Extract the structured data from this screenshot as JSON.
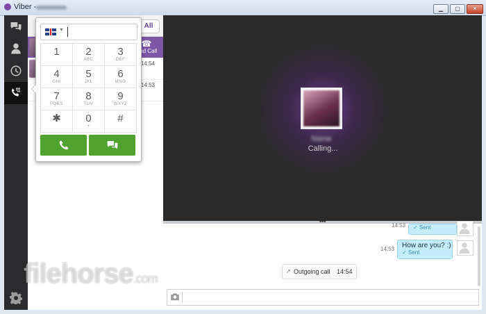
{
  "window": {
    "title": "Viber -",
    "buttons": {
      "min": "▁",
      "max": "▢",
      "close": "✕"
    }
  },
  "nav": {
    "items": [
      "chats-icon",
      "contacts-icon",
      "recents-icon",
      "dialpad-icon"
    ],
    "active": "dialpad-icon",
    "settings": "gear-icon"
  },
  "contacts": {
    "filter_all": "All",
    "rows": [
      {
        "end_call_label": "End Call"
      },
      {
        "time": "14:54"
      },
      {
        "time": "14:53"
      }
    ]
  },
  "dialpad": {
    "country": "UK",
    "keys": [
      {
        "digit": "1",
        "letters": ""
      },
      {
        "digit": "2",
        "letters": "ABC"
      },
      {
        "digit": "3",
        "letters": "DEF"
      },
      {
        "digit": "4",
        "letters": "GHI"
      },
      {
        "digit": "5",
        "letters": "JKL"
      },
      {
        "digit": "6",
        "letters": "MNO"
      },
      {
        "digit": "7",
        "letters": "PQRS"
      },
      {
        "digit": "8",
        "letters": "TUV"
      },
      {
        "digit": "9",
        "letters": "WXYZ"
      },
      {
        "digit": "✱",
        "letters": ""
      },
      {
        "digit": "0",
        "letters": "+"
      },
      {
        "digit": "#",
        "letters": ""
      }
    ],
    "colors": {
      "green": "#4fa22d"
    }
  },
  "call": {
    "status": "Calling..."
  },
  "chat": {
    "messages": [
      {
        "time": "14:53",
        "text": "",
        "status": "✓ Sent"
      },
      {
        "time": "14:53",
        "text": "How are you? :)",
        "status": "✓ Sent"
      }
    ],
    "outgoing_call": {
      "label": "Outgoing call",
      "time": "14:54"
    }
  },
  "watermark": {
    "text": "filehorse",
    "suffix": ".com"
  },
  "colors": {
    "accent": "#7d56a8",
    "bubble": "#c5ecfb"
  }
}
